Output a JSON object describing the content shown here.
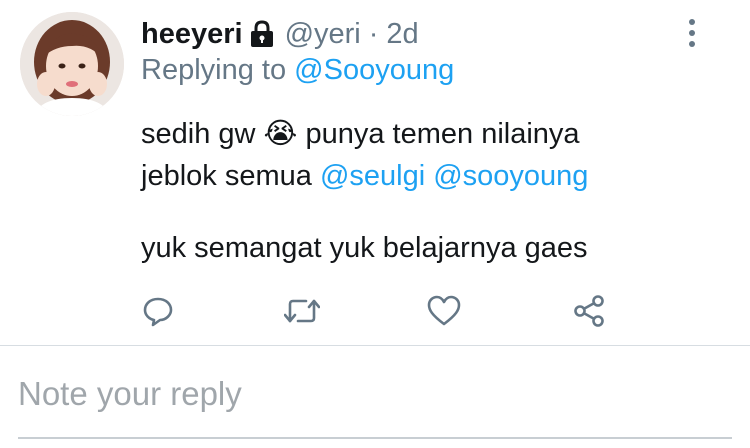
{
  "tweet": {
    "display_name": "heeyeri",
    "handle": "@yeri",
    "separator": "·",
    "time": "2d",
    "replying_prefix": "Replying to",
    "replying_to": "@Sooyoung",
    "line1_text": "sedih gw",
    "line1_emoji": "😭",
    "line1_rest": "punya temen nilainya",
    "line2_text": "jeblok semua",
    "line2_mention1": "@seulgi",
    "line2_mention2": "@sooyoung",
    "line3_text": "yuk semangat yuk belajarnya gaes"
  },
  "icons": {
    "lock": "lock-icon",
    "more": "more-vertical-icon",
    "reply": "reply-icon",
    "retweet": "retweet-icon",
    "like": "heart-icon",
    "share": "share-icon"
  },
  "reply": {
    "placeholder": "Note your reply"
  },
  "colors": {
    "link": "#1da1f2",
    "secondary_text": "#657786",
    "icon_gray": "#657786",
    "divider": "#d7dde2"
  }
}
